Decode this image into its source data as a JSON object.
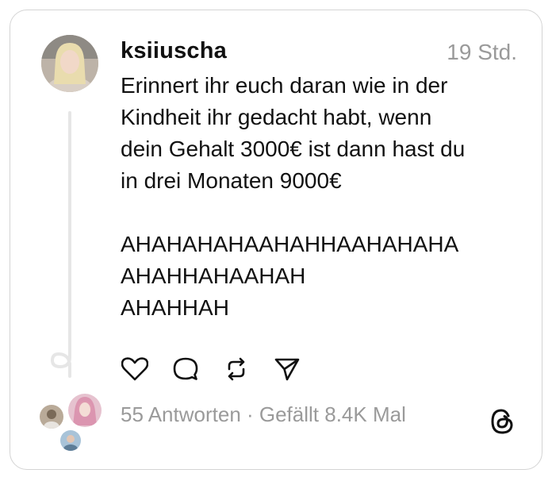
{
  "post": {
    "username": "ksiiuscha",
    "time": "19 Std.",
    "text": "Erinnert ihr euch daran wie in der\nKindheit ihr gedacht habt, wenn\ndein Gehalt 3000€ ist dann hast du\nin drei Monaten 9000€\n\nAHAHAHAHAAHAHHAAHAHAHA\nAHAHHAHAAHAH\nAHAHHAH",
    "stats": "55 Antworten · Gefällt 8.4K Mal"
  },
  "icons": {
    "like": "heart-icon",
    "reply": "comment-icon",
    "repost": "repost-icon",
    "share": "send-icon",
    "logo": "threads-logo-icon"
  },
  "colors": {
    "text": "#111111",
    "muted": "#9a9a9a",
    "border": "#d4d4d4",
    "thread_line": "#e6e6e6"
  }
}
